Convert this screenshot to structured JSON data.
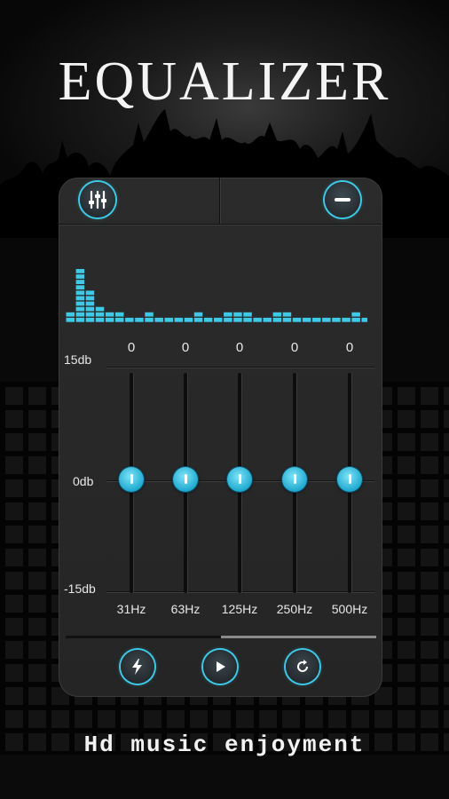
{
  "title": "EQUALIZER",
  "tagline": "Hd music enjoyment",
  "colors": {
    "accent": "#3ec9e6",
    "panel": "#2a2a2a",
    "background": "#050505"
  },
  "toolbar": {
    "left_icon": "equalizer-sliders-icon",
    "right_icon": "minus-icon"
  },
  "scale": {
    "max_label": "15db",
    "mid_label": "0db",
    "min_label": "-15db"
  },
  "bands": [
    {
      "value": "0",
      "freq": "31Hz",
      "level": 0
    },
    {
      "value": "0",
      "freq": "63Hz",
      "level": 0
    },
    {
      "value": "0",
      "freq": "125Hz",
      "level": 0
    },
    {
      "value": "0",
      "freq": "250Hz",
      "level": 0
    },
    {
      "value": "0",
      "freq": "500Hz",
      "level": 0
    }
  ],
  "spectrum_levels": [
    1,
    9,
    5,
    2,
    1,
    1,
    0,
    0,
    1,
    0,
    0,
    0,
    0,
    1,
    0,
    0,
    1,
    1,
    1,
    0,
    0,
    1,
    1,
    0,
    0,
    0,
    0,
    0,
    0,
    1,
    0,
    0,
    0,
    0,
    0
  ],
  "playback": {
    "progress": 0.5
  },
  "controls": [
    "lightning-icon",
    "play-icon",
    "refresh-icon"
  ]
}
